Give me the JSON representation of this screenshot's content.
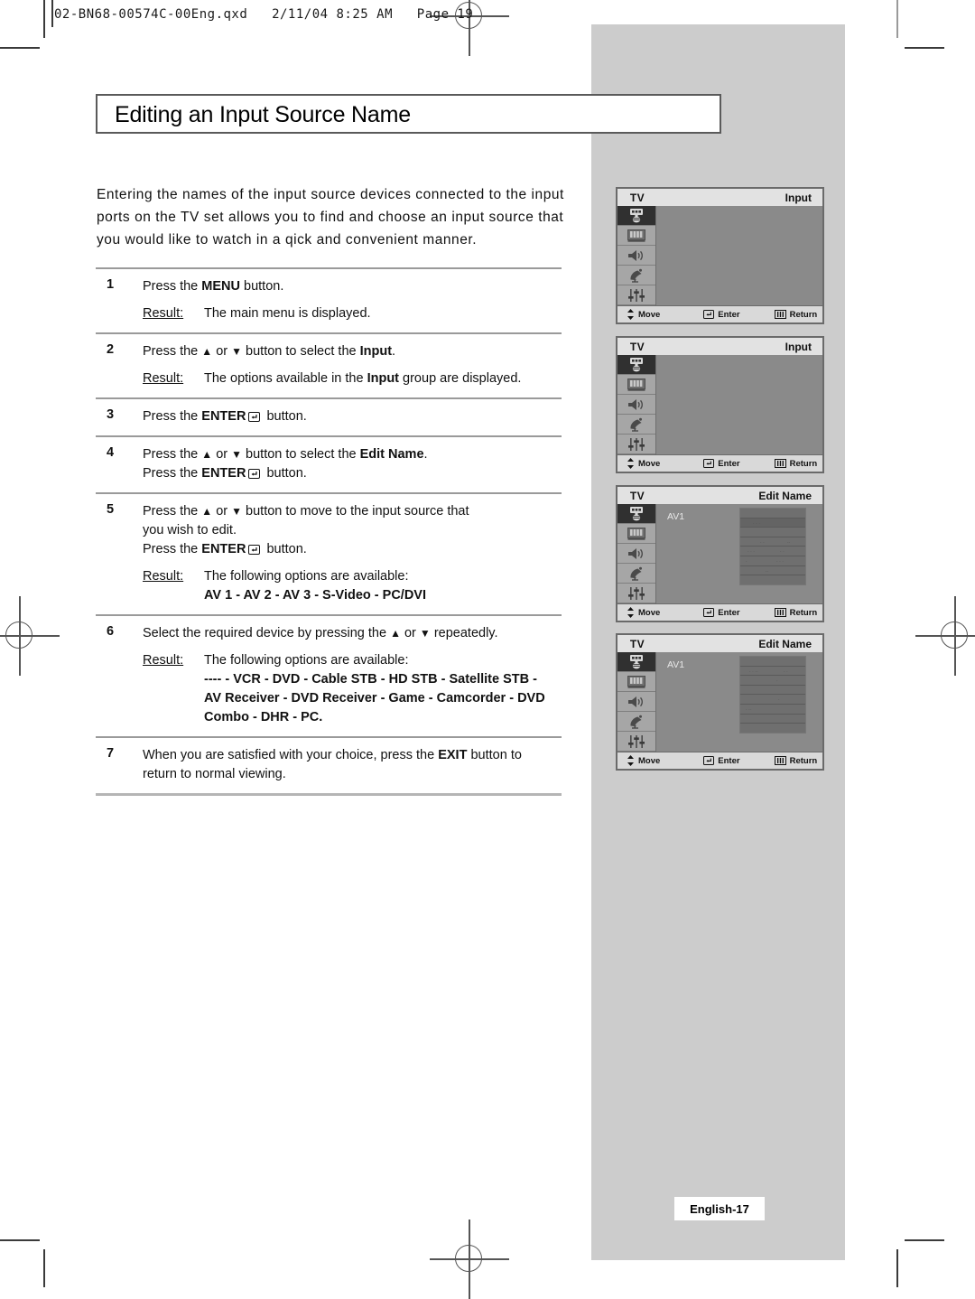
{
  "file_header": "02-BN68-00574C-00Eng.qxd   2/11/04 8:25 AM   Page 19",
  "title": "Editing an Input Source Name",
  "intro": {
    "line1": "Entering the names of the input source devices connected to the input",
    "line2": "ports on the TV set allows you to find and choose an input source that",
    "line3": "you would like to watch in a qick and convenient manner."
  },
  "result_label": "Result:",
  "steps": [
    {
      "num": "1",
      "lines": [
        "Press the MENU button."
      ],
      "result": "The main menu is displayed."
    },
    {
      "num": "2",
      "lines": [
        "Press the ▲ or ▼ button to select the Input."
      ],
      "result": "The options available in the Input group are displayed."
    },
    {
      "num": "3",
      "lines": [
        "Press the ENTER button."
      ],
      "result": ""
    },
    {
      "num": "4",
      "lines": [
        "Press the ▲ or ▼ button to select the Edit Name.",
        "Press the ENTER button."
      ],
      "result": ""
    },
    {
      "num": "5",
      "lines": [
        "Press the ▲ or ▼ button to move to the input source that",
        "you wish to edit.",
        "Press the ENTER button."
      ],
      "result": "The following options are available:",
      "result_bold": [
        "AV 1 - AV 2 - AV 3 - S-Video - PC/DVI"
      ]
    },
    {
      "num": "6",
      "lines": [
        "Select the required device by pressing the ▲ or ▼ repeatedly."
      ],
      "result": "The following options are available:",
      "result_bold": [
        "---- - VCR - DVD - Cable STB - HD STB - Satellite STB -",
        "AV Receiver - DVD Receiver - Game - Camcorder - DVD",
        "Combo - DHR - PC."
      ]
    },
    {
      "num": "7",
      "lines": [
        "When you are satisfied with your choice, press the EXIT button to",
        "return to normal viewing."
      ],
      "result": ""
    }
  ],
  "osd_panels": [
    {
      "tv_label": "TV",
      "title": "Input",
      "av_label": "",
      "has_namebox": false,
      "active_index": 0
    },
    {
      "tv_label": "TV",
      "title": "Input",
      "av_label": "",
      "has_namebox": false,
      "active_index": 0
    },
    {
      "tv_label": "TV",
      "title": "Edit Name",
      "av_label": "AV1",
      "has_namebox": true,
      "active_index": 0
    },
    {
      "tv_label": "TV",
      "title": "Edit Name",
      "av_label": "AV1",
      "has_namebox": true,
      "active_index": 0
    }
  ],
  "osd_sidebar_icons": [
    "input-plug-icon",
    "picture-screen-icon",
    "speaker-volume-icon",
    "satellite-dish-icon",
    "setup-sliders-icon"
  ],
  "osd_footer": {
    "move": "Move",
    "enter": "Enter",
    "return": "Return",
    "move_icon": "up-down-arrows-icon",
    "enter_icon": "enter-key-icon",
    "return_icon": "menu-bars-icon"
  },
  "page_footer": "English-17"
}
